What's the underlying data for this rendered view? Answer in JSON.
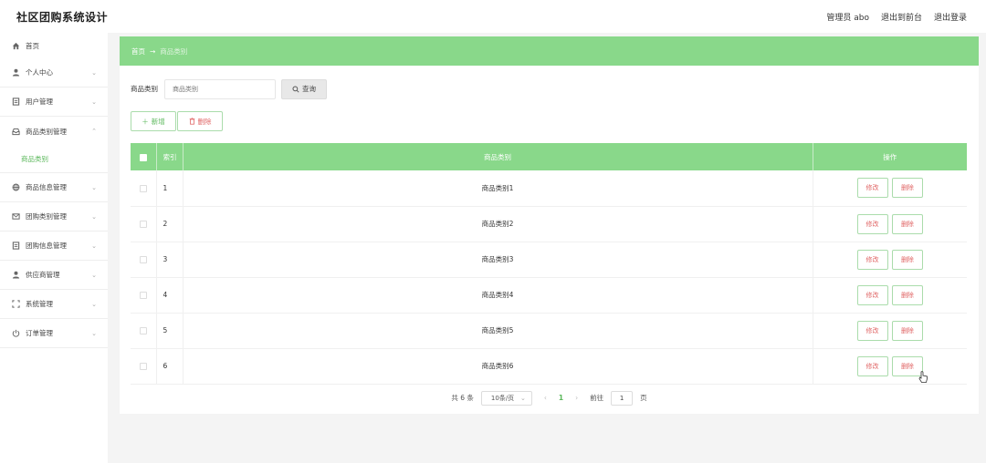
{
  "header": {
    "app_title": "社区团购系统设计",
    "admin_label": "管理员 abo",
    "to_frontend": "退出到前台",
    "logout": "退出登录"
  },
  "sidebar": {
    "items": [
      {
        "label": "首页",
        "icon": "home-icon"
      },
      {
        "label": "个人中心",
        "icon": "user-icon"
      },
      {
        "label": "用户管理",
        "icon": "document-icon"
      },
      {
        "label": "商品类别管理",
        "icon": "inbox-icon"
      },
      {
        "label": "商品信息管理",
        "icon": "globe-icon"
      },
      {
        "label": "团购类别管理",
        "icon": "mail-icon"
      },
      {
        "label": "团购信息管理",
        "icon": "document-icon"
      },
      {
        "label": "供应商管理",
        "icon": "user-icon"
      },
      {
        "label": "系统管理",
        "icon": "fullscreen-icon"
      },
      {
        "label": "订单管理",
        "icon": "power-icon"
      }
    ],
    "active_submenu": "商品类别"
  },
  "breadcrumb": {
    "home": "首页",
    "arrow": "→",
    "current": "商品类别"
  },
  "search": {
    "label": "商品类别",
    "placeholder": "商品类别",
    "query_button": "查询"
  },
  "actions": {
    "add": "新增",
    "delete": "删除"
  },
  "table": {
    "columns": [
      "索引",
      "商品类别",
      "操作"
    ],
    "rows": [
      {
        "index": "1",
        "name": "商品类别1"
      },
      {
        "index": "2",
        "name": "商品类别2"
      },
      {
        "index": "3",
        "name": "商品类别3"
      },
      {
        "index": "4",
        "name": "商品类别4"
      },
      {
        "index": "5",
        "name": "商品类别5"
      },
      {
        "index": "6",
        "name": "商品类别6"
      }
    ],
    "edit_label": "修改",
    "delete_label": "删除"
  },
  "pagination": {
    "total": "共 6 条",
    "page_size": "10条/页",
    "current_page": "1",
    "goto_label": "前往",
    "goto_value": "1",
    "page_suffix": "页"
  },
  "colors": {
    "accent": "#89d88a",
    "danger": "#e06666"
  }
}
